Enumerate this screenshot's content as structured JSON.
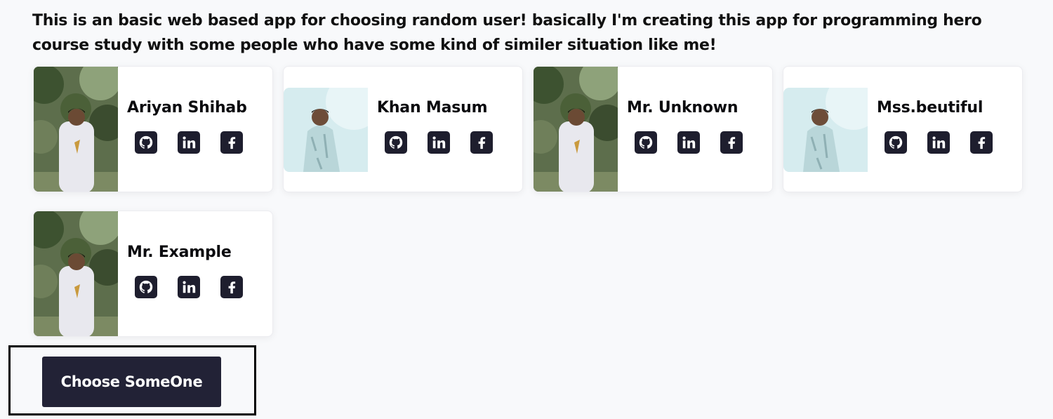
{
  "intro_text": "This is an basic web based app for choosing random user! basically I'm creating this app for programming hero course study with some people who have some kind of similer situation like me!",
  "users": [
    {
      "name": "Ariyan Shihab",
      "photo": "forest-portrait"
    },
    {
      "name": "Khan Masum",
      "photo": "light-portrait"
    },
    {
      "name": "Mr. Unknown",
      "photo": "forest-portrait"
    },
    {
      "name": "Mss.beutiful",
      "photo": "light-portrait"
    },
    {
      "name": "Mr. Example",
      "photo": "forest-portrait"
    }
  ],
  "social_icons": [
    "github-icon",
    "linkedin-icon",
    "facebook-icon"
  ],
  "choose_button_label": "Choose SomeOne",
  "colors": {
    "background": "#f8f9fb",
    "card": "#ffffff",
    "icon_bg": "#1e1e2e",
    "button_bg": "#222236",
    "button_text": "#ffffff"
  }
}
